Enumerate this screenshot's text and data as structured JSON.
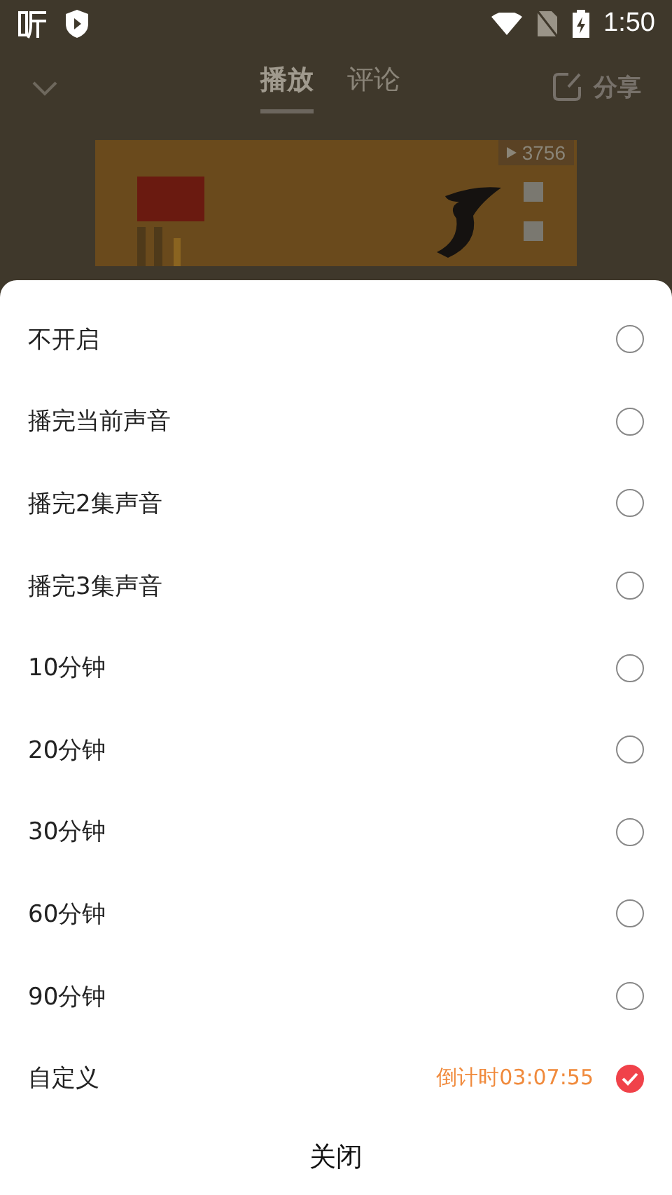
{
  "status_bar": {
    "time": "1:50"
  },
  "header": {
    "tabs": [
      {
        "label": "播放",
        "selected": true
      },
      {
        "label": "评论",
        "selected": false
      }
    ],
    "share": "分享"
  },
  "cover": {
    "play_count": "3756"
  },
  "timer_options": [
    {
      "label": "不开启",
      "selected": false
    },
    {
      "label": "播完当前声音",
      "selected": false
    },
    {
      "label": "播完2集声音",
      "selected": false
    },
    {
      "label": "播完3集声音",
      "selected": false
    },
    {
      "label": "10分钟",
      "selected": false
    },
    {
      "label": "20分钟",
      "selected": false
    },
    {
      "label": "30分钟",
      "selected": false
    },
    {
      "label": "60分钟",
      "selected": false
    },
    {
      "label": "90分钟",
      "selected": false
    },
    {
      "label": "自定义",
      "selected": true,
      "countdown": "倒计时03:07:55"
    }
  ],
  "close_button": "关闭"
}
